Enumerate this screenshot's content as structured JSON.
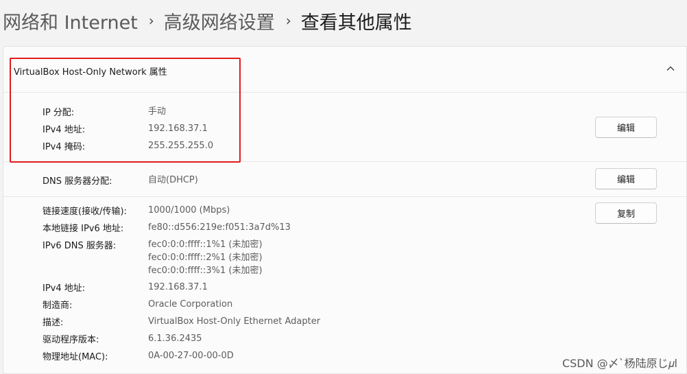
{
  "breadcrumb": {
    "items": [
      "网络和 Internet",
      "高级网络设置",
      "查看其他属性"
    ],
    "separator": "›"
  },
  "card": {
    "title": "VirtualBox Host-Only Network 属性",
    "toggle_icon": "chevron-up-icon"
  },
  "ip_section": {
    "rows": [
      {
        "label": "IP 分配:",
        "value": "手动"
      },
      {
        "label": "IPv4 地址:",
        "value": "192.168.37.1"
      },
      {
        "label": "IPv4 掩码:",
        "value": "255.255.255.0"
      }
    ],
    "edit_label": "编辑"
  },
  "dns_section": {
    "label": "DNS 服务器分配:",
    "value": "自动(DHCP)",
    "edit_label": "编辑"
  },
  "details_section": {
    "copy_label": "复制",
    "rows": [
      {
        "label": "链接速度(接收/传输):",
        "value": "1000/1000 (Mbps)"
      },
      {
        "label": "本地链接 IPv6 地址:",
        "value": "fe80::d556:219e:f051:3a7d%13"
      },
      {
        "label": "IPv6 DNS 服务器:",
        "values": [
          "fec0:0:0:ffff::1%1 (未加密)",
          "fec0:0:0:ffff::2%1 (未加密)",
          "fec0:0:0:ffff::3%1 (未加密)"
        ]
      },
      {
        "label": "IPv4 地址:",
        "value": "192.168.37.1"
      },
      {
        "label": "制造商:",
        "value": "Oracle Corporation"
      },
      {
        "label": "描述:",
        "value": "VirtualBox Host-Only Ethernet Adapter"
      },
      {
        "label": "驱动程序版本:",
        "value": "6.1.36.2435"
      },
      {
        "label": "物理地址(MAC):",
        "value": "0A-00-27-00-00-0D"
      }
    ]
  },
  "watermark": "CSDN @〆`杨陆原じ𝜇l",
  "colors": {
    "highlight": "#e01b1b",
    "background": "#f3f3f3",
    "card": "#fbfbfb"
  }
}
